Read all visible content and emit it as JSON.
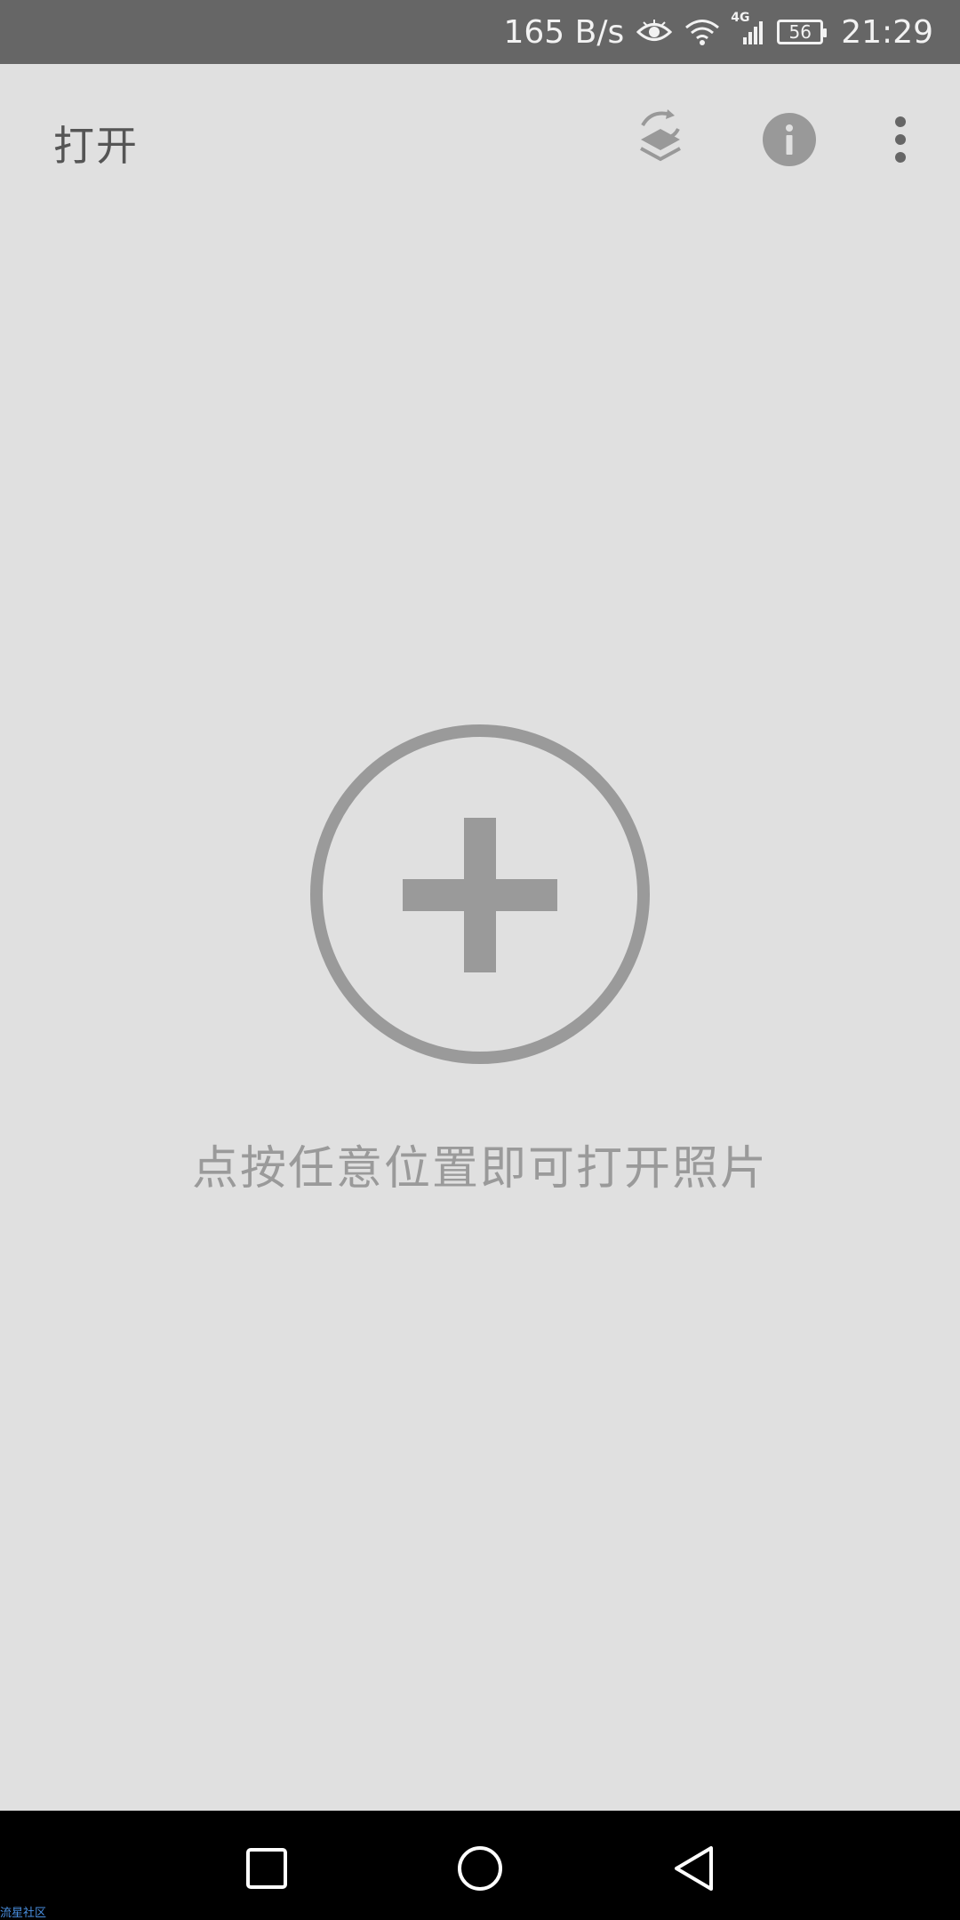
{
  "status_bar": {
    "net_speed": "165 B/s",
    "network_type": "4G",
    "battery": "56",
    "time": "21:29",
    "icons": [
      "eye-icon",
      "wifi-icon",
      "signal-icon",
      "battery-icon"
    ]
  },
  "app_bar": {
    "title": "打开",
    "actions": [
      "layers-sync-icon",
      "info-icon",
      "more-vert-icon"
    ]
  },
  "main": {
    "add_icon": "add-circle-icon",
    "hint": "点按任意位置即可打开照片"
  },
  "nav_bar": {
    "buttons": [
      "recents-square-icon",
      "home-circle-icon",
      "back-triangle-icon"
    ]
  },
  "watermark": "流星社区",
  "colors": {
    "status_bar": "#666666",
    "background": "#e0e0e0",
    "icon_gray": "#9a9a9a",
    "nav_bar": "#000000"
  }
}
